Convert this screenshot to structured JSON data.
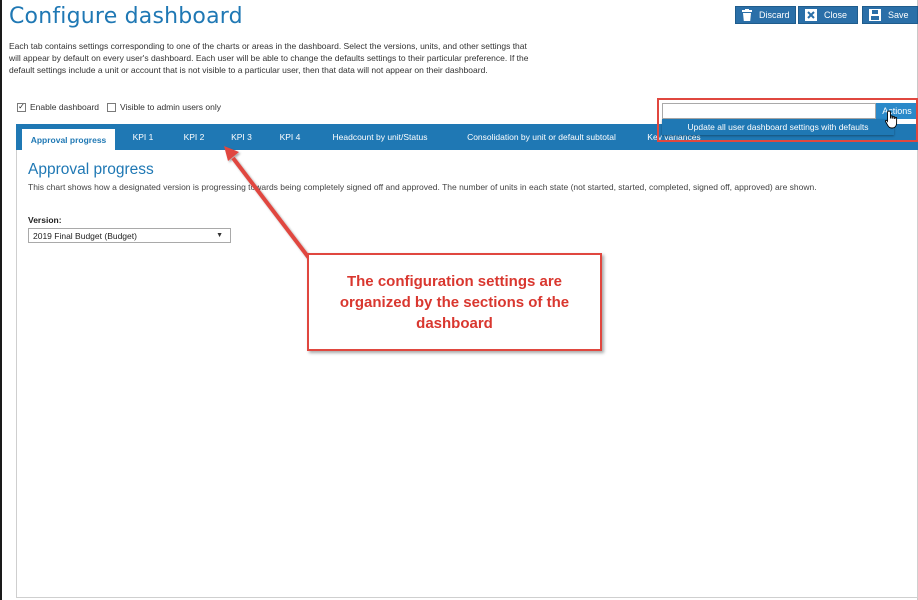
{
  "header": {
    "title": "Configure dashboard",
    "description": "Each tab contains settings corresponding to one of the charts or areas in the dashboard. Select the versions, units, and other settings that will appear by default on every user's dashboard. Each user will be able to change the defaults settings to their particular preference. If the default settings include a unit or account that is not visible to a particular user, then that data will not appear on their dashboard."
  },
  "toolbar": {
    "discard_label": "Discard",
    "close_label": "Close",
    "save_label": "Save"
  },
  "options": {
    "enable_dashboard_label": "Enable dashboard",
    "enable_dashboard_checked": true,
    "visible_admin_label": "Visible to admin users only",
    "visible_admin_checked": false
  },
  "actions": {
    "button_label": "Actions",
    "input_value": "",
    "menu_item": "Update all user dashboard settings with defaults"
  },
  "tabs": [
    {
      "label": "Approval progress",
      "active": true
    },
    {
      "label": "KPI 1"
    },
    {
      "label": "KPI 2"
    },
    {
      "label": "KPI 3"
    },
    {
      "label": "KPI 4"
    },
    {
      "label": "Headcount by unit/Status"
    },
    {
      "label": "Consolidation by unit or default subtotal"
    },
    {
      "label": "Key variances"
    }
  ],
  "section": {
    "title": "Approval progress",
    "description": "This chart shows how a designated version is progressing towards being completely signed off and approved. The number of units in each state (not started, started, completed, signed off, approved) are shown.",
    "version_label": "Version:",
    "version_value": "2019 Final Budget (Budget)"
  },
  "callout": {
    "text": "The configuration settings are organized by the sections of the dashboard"
  },
  "colors": {
    "accent": "#1f78b4",
    "callout_red": "#e0473f"
  }
}
